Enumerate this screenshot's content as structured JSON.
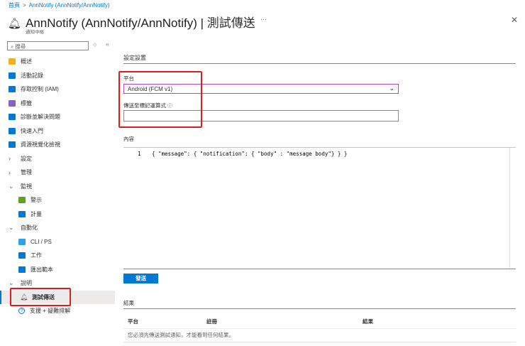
{
  "breadcrumb": {
    "home": "首頁",
    "current": "AnnNotify (AnnNotify/AnnNotify)"
  },
  "header": {
    "title": "AnnNotify (AnnNotify/AnnNotify)",
    "page": "測試傳送",
    "subtitle": "通知中樞",
    "more": "···"
  },
  "search": {
    "placeholder": "搜尋"
  },
  "sidebar": {
    "items": [
      {
        "label": "概述",
        "icon": "overview-icon",
        "color": "#f2b01e"
      },
      {
        "label": "活動記錄",
        "icon": "activity-log-icon",
        "color": "#0078d4"
      },
      {
        "label": "存取控制 (IAM)",
        "icon": "iam-icon",
        "color": "#0078d4"
      },
      {
        "label": "標籤",
        "icon": "tag-icon",
        "color": "#8661c5"
      },
      {
        "label": "診斷並解決問題",
        "icon": "diagnose-icon",
        "color": "#0078d4"
      },
      {
        "label": "快速入門",
        "icon": "quickstart-icon",
        "color": "#0078d4"
      },
      {
        "label": "資源視覺化檢視",
        "icon": "resource-visualizer-icon",
        "color": "#0078d4"
      },
      {
        "label": "設定",
        "icon": "chevron-right-icon"
      },
      {
        "label": "管理",
        "icon": "chevron-right-icon"
      },
      {
        "label": "監視",
        "icon": "chevron-down-icon"
      },
      {
        "label": "警示",
        "icon": "alerts-icon",
        "color": "#5ea51d"
      },
      {
        "label": "計量",
        "icon": "metrics-icon",
        "color": "#0078d4"
      },
      {
        "label": "自動化",
        "icon": "chevron-down-icon"
      },
      {
        "label": "CLI / PS",
        "icon": "cli-icon",
        "color": "#32a0e0"
      },
      {
        "label": "工作",
        "icon": "tasks-icon",
        "color": "#0078d4"
      },
      {
        "label": "匯出範本",
        "icon": "export-template-icon",
        "color": "#0078d4"
      },
      {
        "label": "說明",
        "icon": "chevron-down-icon"
      },
      {
        "label": "測試傳送",
        "icon": "bell-icon"
      },
      {
        "label": "支援 + 疑難排解",
        "icon": "help-icon",
        "color": "#0078d4"
      }
    ]
  },
  "main": {
    "section_title": "設定設置",
    "platform_label": "平台",
    "platform_value": "Android (FCM v1)",
    "tag_label": "傳送至標記運算式",
    "tag_value": "",
    "content_label": "內容",
    "code_line_number": "1",
    "code": "{ \"message\": { \"notification\": { \"body\" : \"message body\"} } }",
    "send_label": "發送",
    "results_title": "結果",
    "columns": [
      "平台",
      "註冊",
      "結果"
    ],
    "empty_message": "您必須先傳送測試通知，才能看到任何結果。"
  }
}
